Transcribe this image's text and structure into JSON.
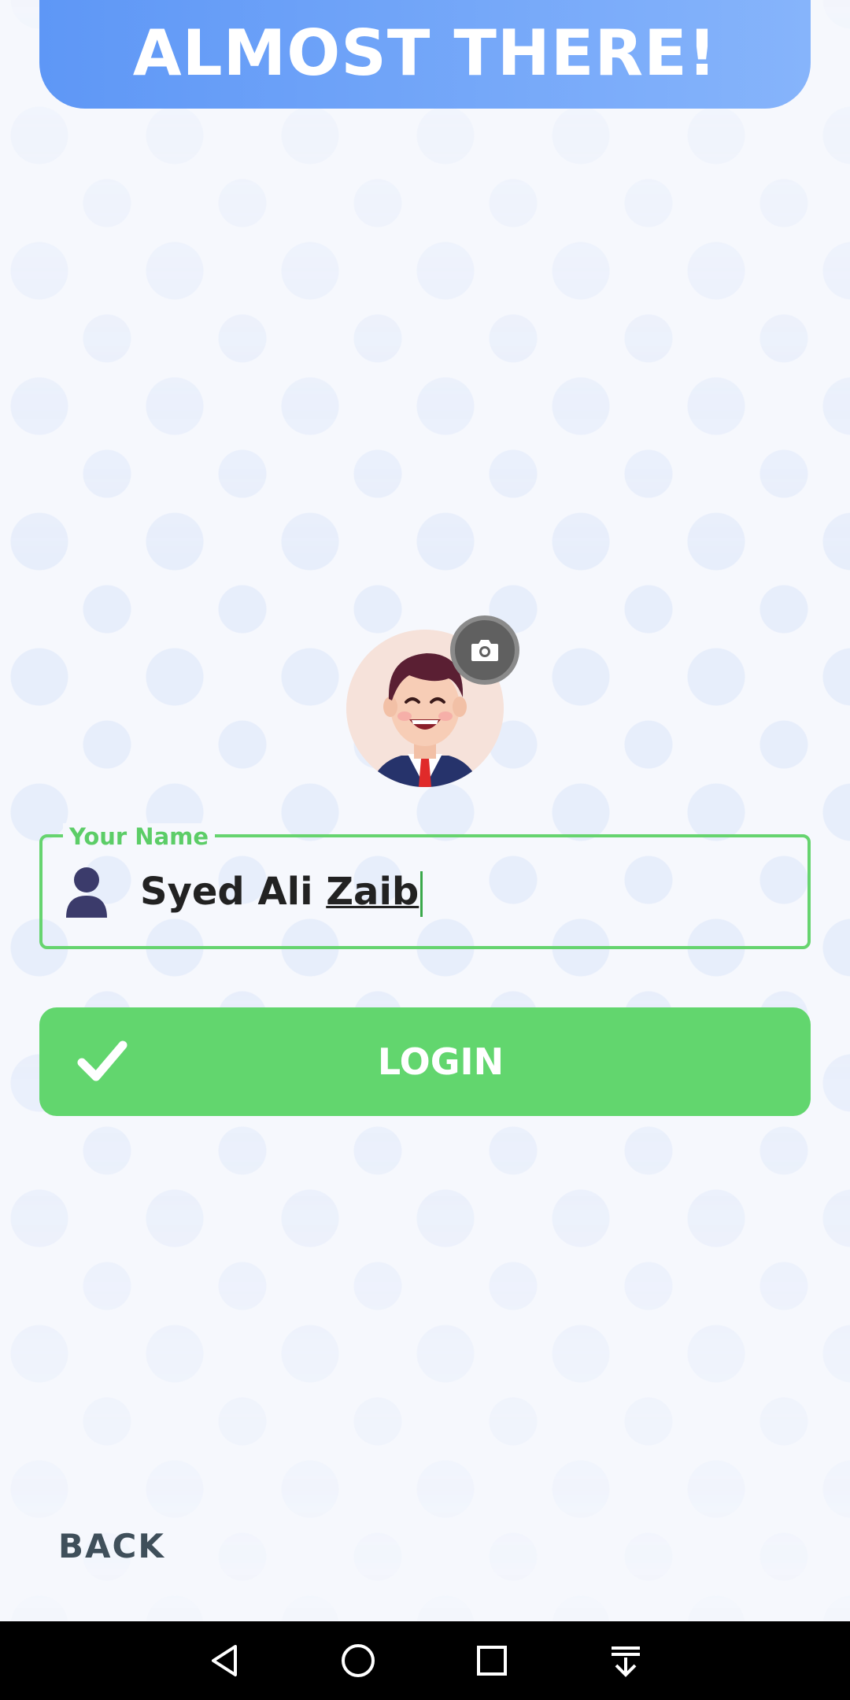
{
  "header": {
    "title": "ALMOST THERE!"
  },
  "profile": {
    "avatar_icon": "cartoon-businessman-avatar",
    "camera_icon": "camera-icon"
  },
  "name_field": {
    "label": "Your Name",
    "value_part1": "Syed Ali ",
    "value_part2": "Zaib",
    "icon": "person-icon"
  },
  "login_button": {
    "label": "LOGIN",
    "icon": "check-icon"
  },
  "back_button": {
    "label": "BACK"
  },
  "navigation_bar": {
    "items": [
      "back-icon",
      "home-icon",
      "recents-icon",
      "notification-pull-down-icon"
    ]
  },
  "colors": {
    "accent_blue": "#5e97f6",
    "accent_green": "#62d66e",
    "back_text": "#3f4f5a"
  }
}
